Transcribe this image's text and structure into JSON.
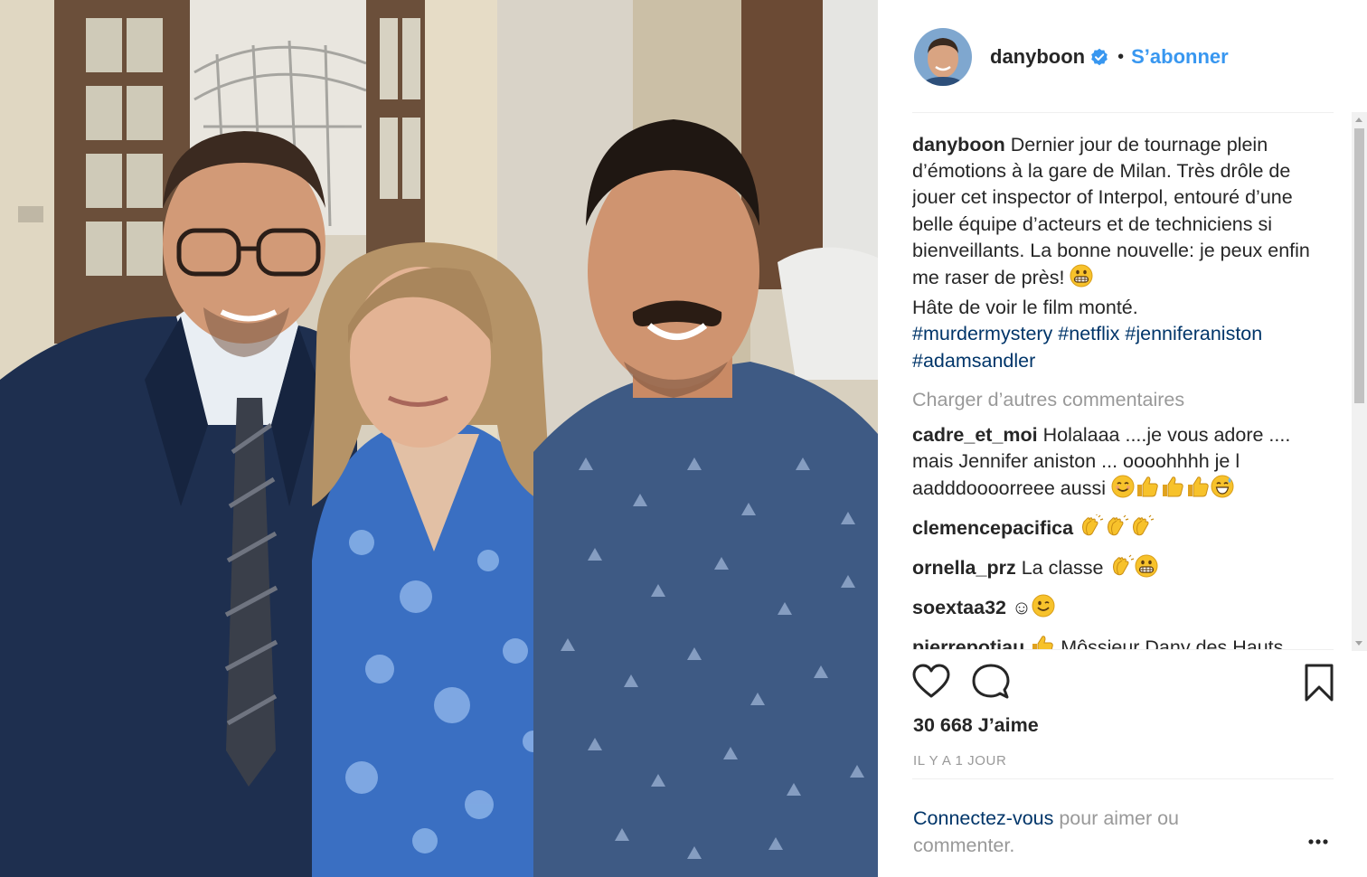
{
  "post": {
    "username": "danyboon",
    "separator": "•",
    "follow_label": "S’abonner",
    "caption": {
      "username": "danyboon",
      "text": "Dernier jour de tournage plein d’émotions à la gare de Milan. Très drôle de jouer cet inspector of Interpol, entouré d’une belle équipe d’acteurs et de techniciens si bienveillants. La bonne nouvelle: je peux enfin me raser de près!",
      "text2": "Hâte de voir le film monté.",
      "hashtags": [
        "#murdermystery",
        "#netflix",
        "#jenniferaniston",
        "#adamsandler"
      ]
    },
    "load_more": "Charger d’autres commentaires",
    "comments": [
      {
        "user": "cadre_et_moi",
        "text": "Holalaaa ....je vous adore .... mais Jennifer aniston ... oooohhhh je l aadddoooorreee aussi"
      },
      {
        "user": "clemencepacifica",
        "text": ""
      },
      {
        "user": "ornella_prz",
        "text": "La classe"
      },
      {
        "user": "soextaa32",
        "text": "☺"
      },
      {
        "user": "pierrepotiau",
        "text": "Môssieur Dany des Hauts de France"
      }
    ],
    "likes": "30 668 J’aime",
    "time_ago": "IL Y A 1 JOUR",
    "login": {
      "link": "Connectez-vous",
      "rest": " pour aimer ou commenter."
    }
  },
  "colors": {
    "accent": "#3897f0",
    "hashtag": "#003569",
    "muted": "#999999",
    "text": "#262626",
    "emoji": "#f7c22b"
  },
  "icons": [
    "verified-badge-icon",
    "heart-icon",
    "comment-icon",
    "bookmark-icon",
    "more-options-icon",
    "grin-emoji",
    "thumbs-up-emoji",
    "clapping-emoji",
    "wink-emoji",
    "smile-emoji",
    "sweat-smile-emoji"
  ]
}
